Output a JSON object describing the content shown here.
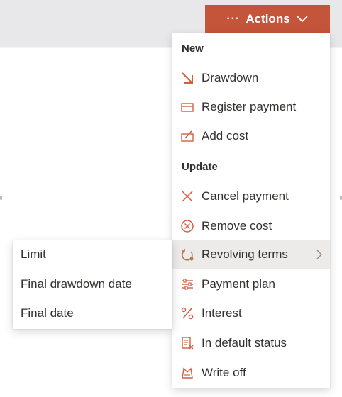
{
  "header": {
    "actions_dots": "···",
    "actions_label": "Actions"
  },
  "menu": {
    "sections": [
      {
        "title": "New",
        "items": [
          {
            "label": "Drawdown",
            "icon": "arrow-down-right-icon"
          },
          {
            "label": "Register payment",
            "icon": "card-icon"
          },
          {
            "label": "Add cost",
            "icon": "edit-card-icon"
          }
        ]
      },
      {
        "title": "Update",
        "items": [
          {
            "label": "Cancel payment",
            "icon": "close-icon"
          },
          {
            "label": "Remove cost",
            "icon": "circle-x-icon"
          },
          {
            "label": "Revolving terms",
            "icon": "revolving-icon",
            "has_submenu": true,
            "active": true
          },
          {
            "label": "Payment plan",
            "icon": "sliders-icon"
          },
          {
            "label": "Interest",
            "icon": "percent-icon"
          },
          {
            "label": "In default status",
            "icon": "document-x-icon"
          },
          {
            "label": "Write off",
            "icon": "write-off-icon"
          }
        ]
      }
    ]
  },
  "submenu": {
    "items": [
      {
        "label": "Limit"
      },
      {
        "label": "Final drawdown date"
      },
      {
        "label": "Final date"
      }
    ]
  },
  "colors": {
    "accent": "#c4543a",
    "icon": "#d2603f",
    "active_bg": "#edebe9",
    "topbar": "#e8e8ea"
  }
}
